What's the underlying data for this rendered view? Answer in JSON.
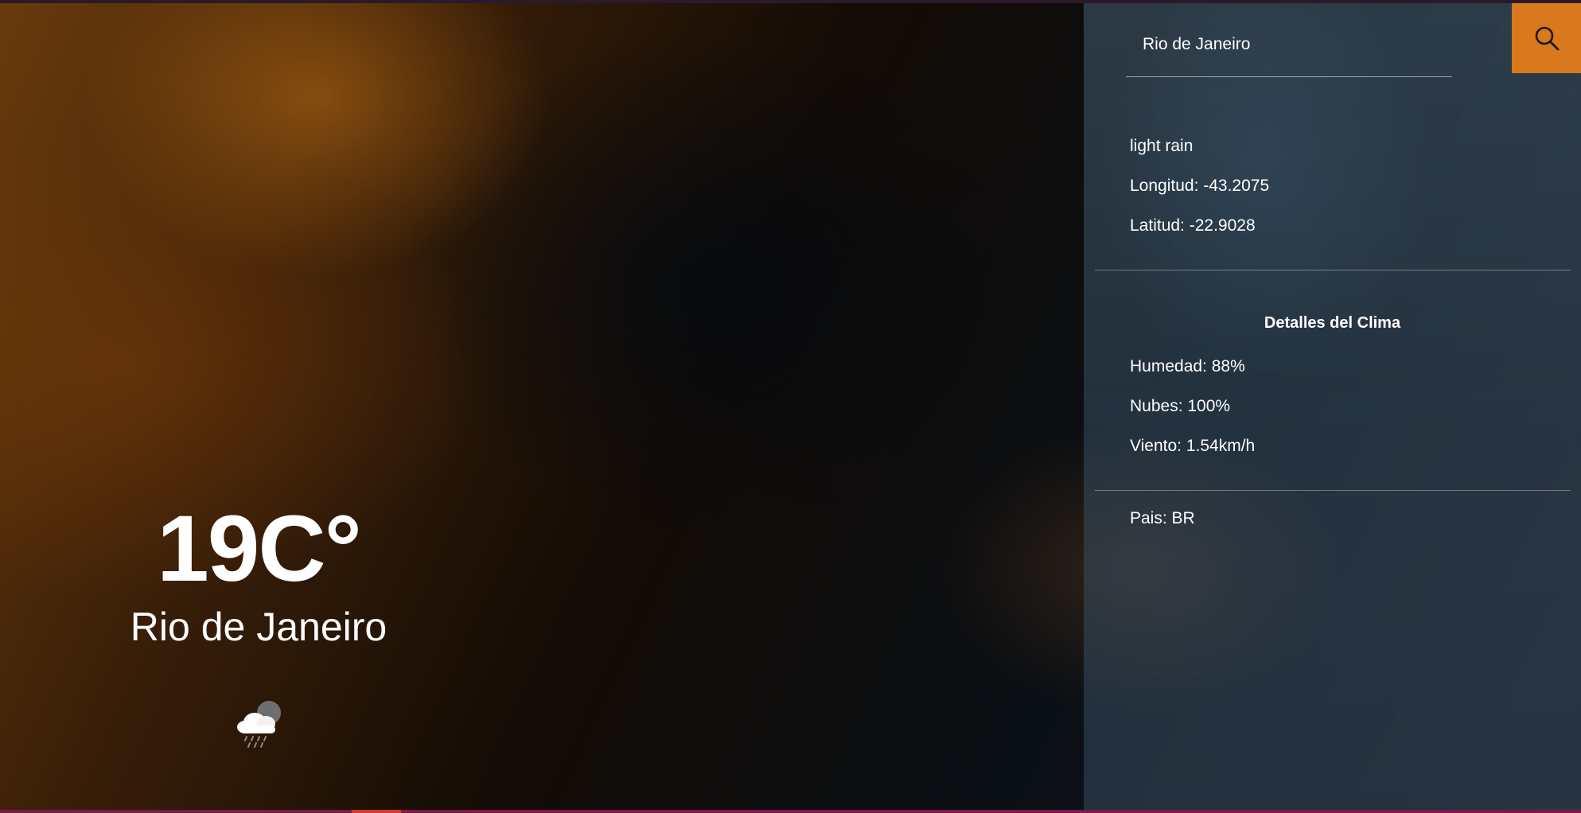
{
  "search": {
    "value": "Rio de Janeiro",
    "placeholder": "",
    "button_icon": "search-icon"
  },
  "current": {
    "temperature": "19C°",
    "city": "Rio de Janeiro",
    "icon": "light-rain-icon"
  },
  "details": {
    "description": "light rain",
    "longitude": "Longitud: -43.2075",
    "latitude": "Latitud: -22.9028",
    "section_title": "Detalles del Clima",
    "humidity": "Humedad: 88%",
    "clouds": "Nubes: 100%",
    "wind": "Viento: 1.54km/h",
    "country": "Pais: BR"
  },
  "colors": {
    "accent": "#d9781c",
    "panel": "#465f73"
  }
}
